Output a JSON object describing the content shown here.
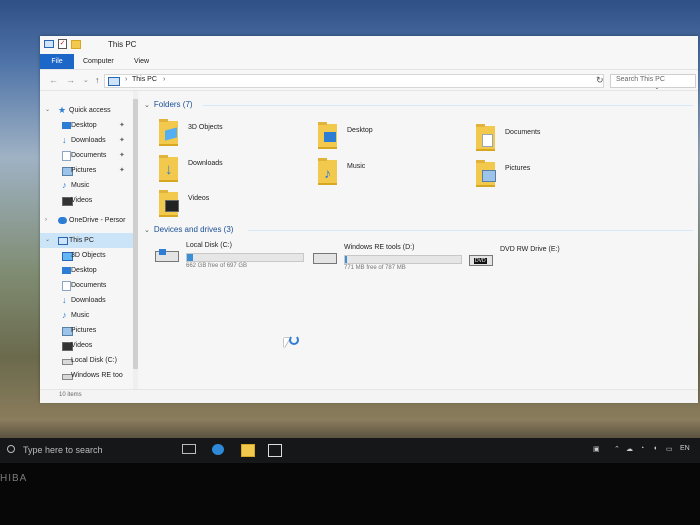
{
  "window": {
    "title": "This PC",
    "tabs": [
      "File",
      "Computer",
      "View"
    ]
  },
  "address": {
    "path": "This PC",
    "search_placeholder": "Search This PC"
  },
  "navigation": {
    "quick_access": "Quick access",
    "quick_items": [
      "Desktop",
      "Downloads",
      "Documents",
      "Pictures",
      "Music",
      "Videos"
    ],
    "onedrive": "OneDrive - Persor",
    "this_pc": "This PC",
    "this_pc_items": [
      "3D Objects",
      "Desktop",
      "Documents",
      "Downloads",
      "Music",
      "Pictures",
      "Videos",
      "Local Disk (C:)",
      "Windows RE too"
    ]
  },
  "content": {
    "folders_header": "Folders (7)",
    "folders": [
      "3D Objects",
      "Desktop",
      "Documents",
      "Downloads",
      "Music",
      "Pictures",
      "Videos"
    ],
    "devices_header": "Devices and drives (3)",
    "drives": [
      {
        "name": "Local Disk (C:)",
        "free": "662 GB free of 697 GB",
        "used_fraction": 0.05
      },
      {
        "name": "Windows RE tools (D:)",
        "free": "771 MB free of 787 MB",
        "used_fraction": 0.02
      },
      {
        "name": "DVD RW Drive (E:)"
      }
    ]
  },
  "status": {
    "items": "10 items"
  },
  "taskbar": {
    "search": "Type here to search",
    "lang": "EN"
  },
  "laptop": {
    "brand": "HIBA"
  }
}
